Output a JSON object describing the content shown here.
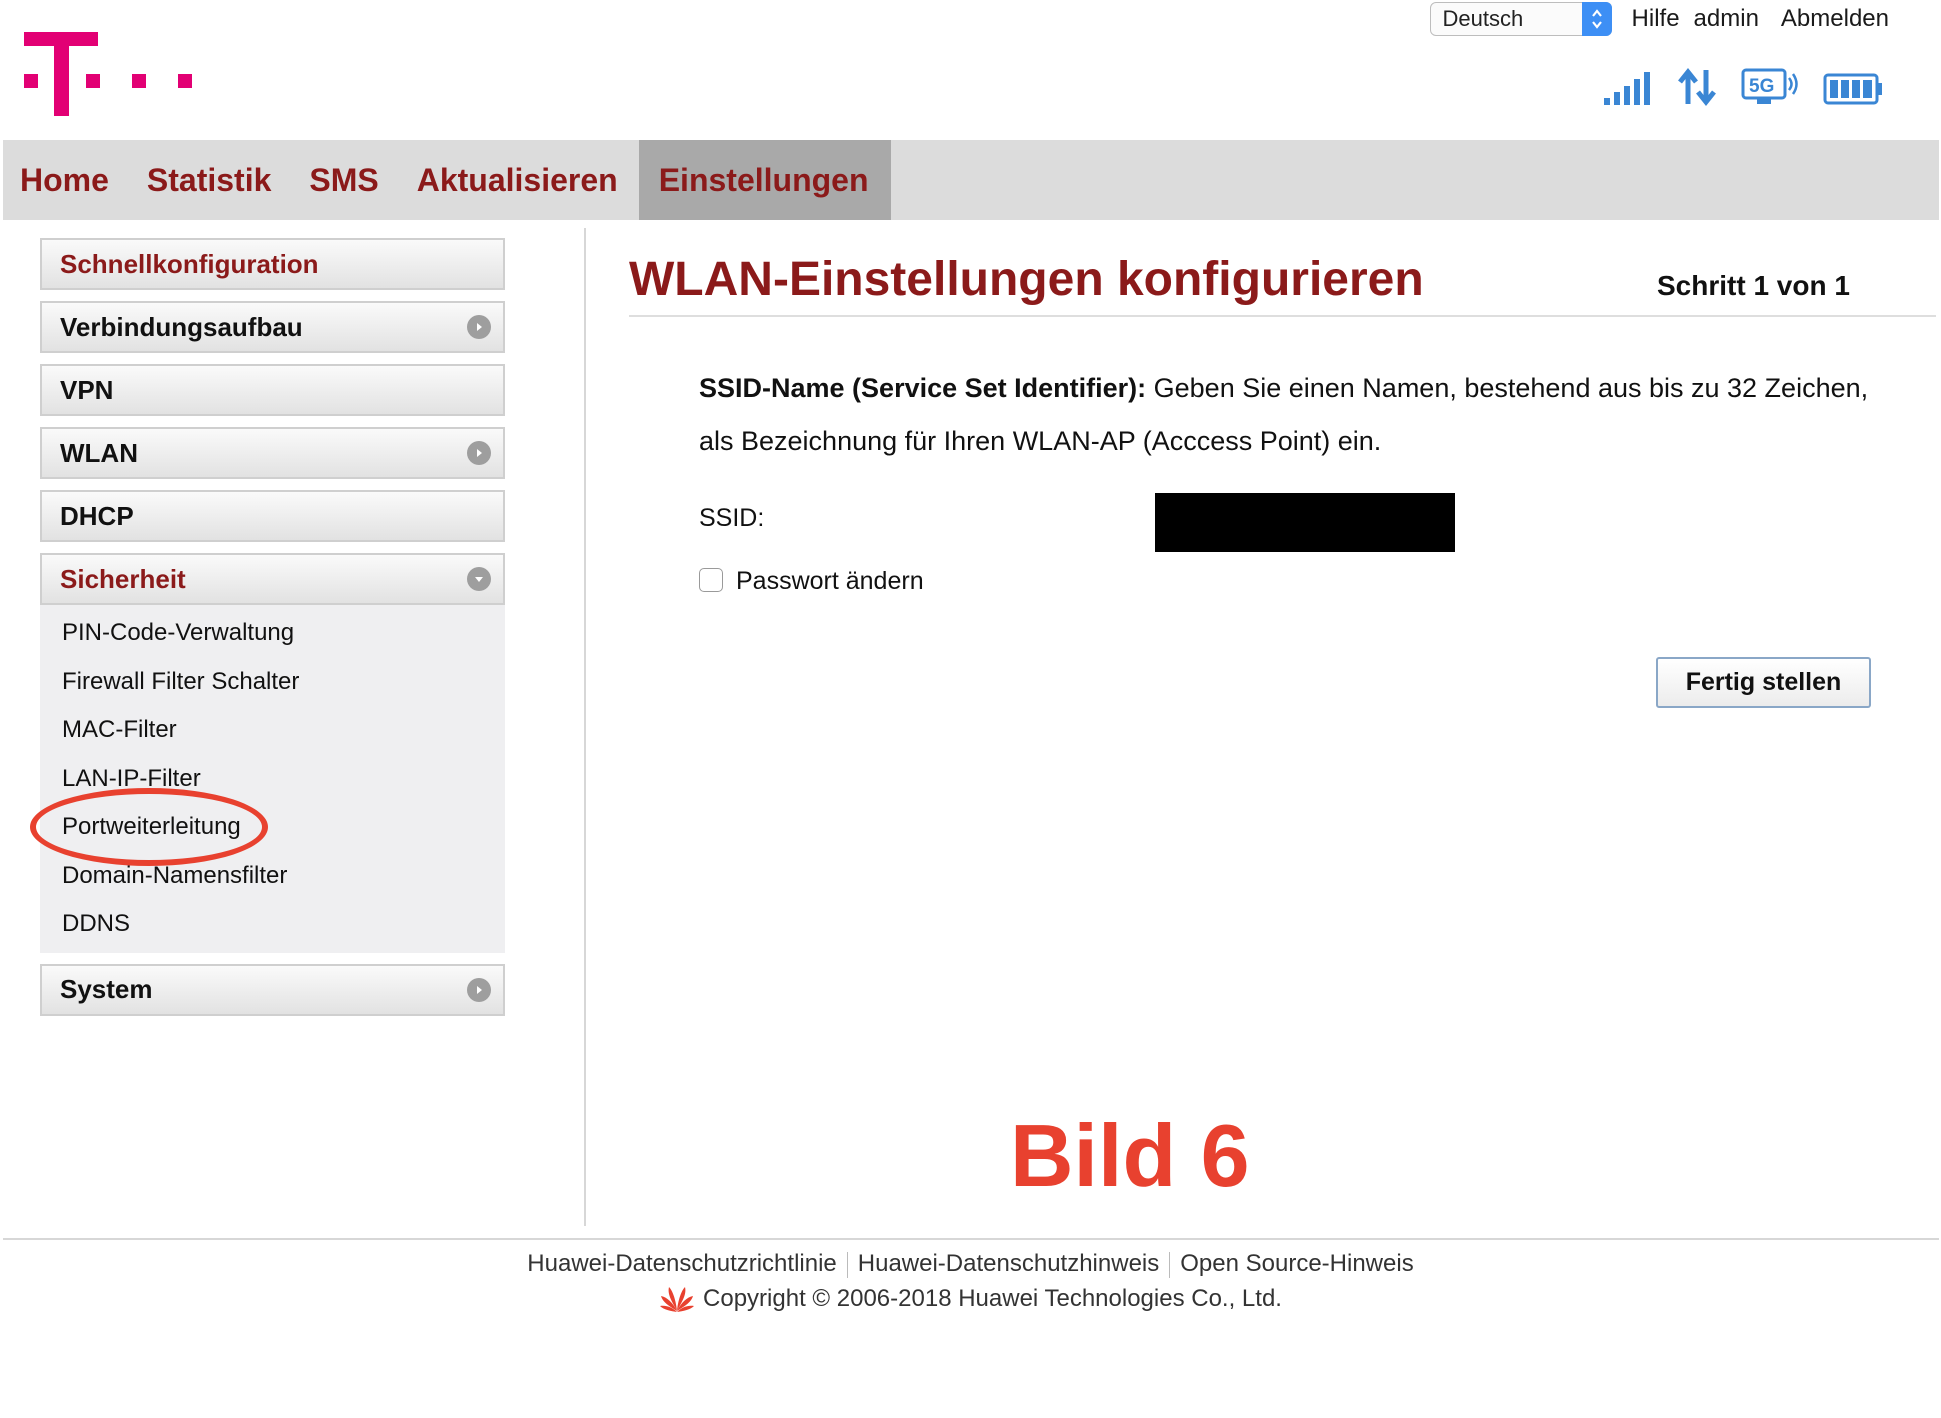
{
  "header": {
    "language": "Deutsch",
    "help_label": "Hilfe",
    "user_label": "admin",
    "logout_label": "Abmelden",
    "brand_color": "#e20074"
  },
  "nav": {
    "items": [
      {
        "label": "Home"
      },
      {
        "label": "Statistik"
      },
      {
        "label": "SMS"
      },
      {
        "label": "Aktualisieren"
      },
      {
        "label": "Einstellungen",
        "active": true
      }
    ]
  },
  "sidebar": {
    "items": [
      {
        "label": "Schnellkonfiguration",
        "highlight": true
      },
      {
        "label": "Verbindungsaufbau",
        "expandable": true
      },
      {
        "label": "VPN"
      },
      {
        "label": "WLAN",
        "expandable": true
      },
      {
        "label": "DHCP"
      },
      {
        "label": "Sicherheit",
        "expanded": true,
        "highlight": true
      },
      {
        "label": "System",
        "expandable": true
      }
    ],
    "security_sub": [
      "PIN-Code-Verwaltung",
      "Firewall Filter Schalter",
      "MAC-Filter",
      "LAN-IP-Filter",
      "Portweiterleitung",
      "Domain-Namensfilter",
      "DDNS"
    ]
  },
  "main": {
    "title": "WLAN-Einstellungen konfigurieren",
    "step": "Schritt 1 von 1",
    "desc_bold": "SSID-Name (Service Set Identifier):",
    "desc_text": " Geben Sie einen Namen, bestehend aus bis zu 32 Zeichen, als Bezeichnung für Ihren WLAN-AP (Acccess Point) ein.",
    "ssid_label": "SSID:",
    "ssid_value": "",
    "change_password_label": "Passwort ändern",
    "finish_button": "Fertig stellen",
    "annotation": "Bild 6"
  },
  "footer": {
    "links": [
      "Huawei-Datenschutzrichtlinie",
      "Huawei-Datenschutzhinweis",
      "Open Source-Hinweis"
    ],
    "copyright": "Copyright © 2006-2018 Huawei Technologies Co., Ltd."
  },
  "icons": {
    "logo": "telekom-logo-icon",
    "signal": "signal-strength-icon",
    "data": "data-transfer-icon",
    "network": "5g-network-icon",
    "battery": "battery-icon",
    "footer": "huawei-logo-icon"
  }
}
